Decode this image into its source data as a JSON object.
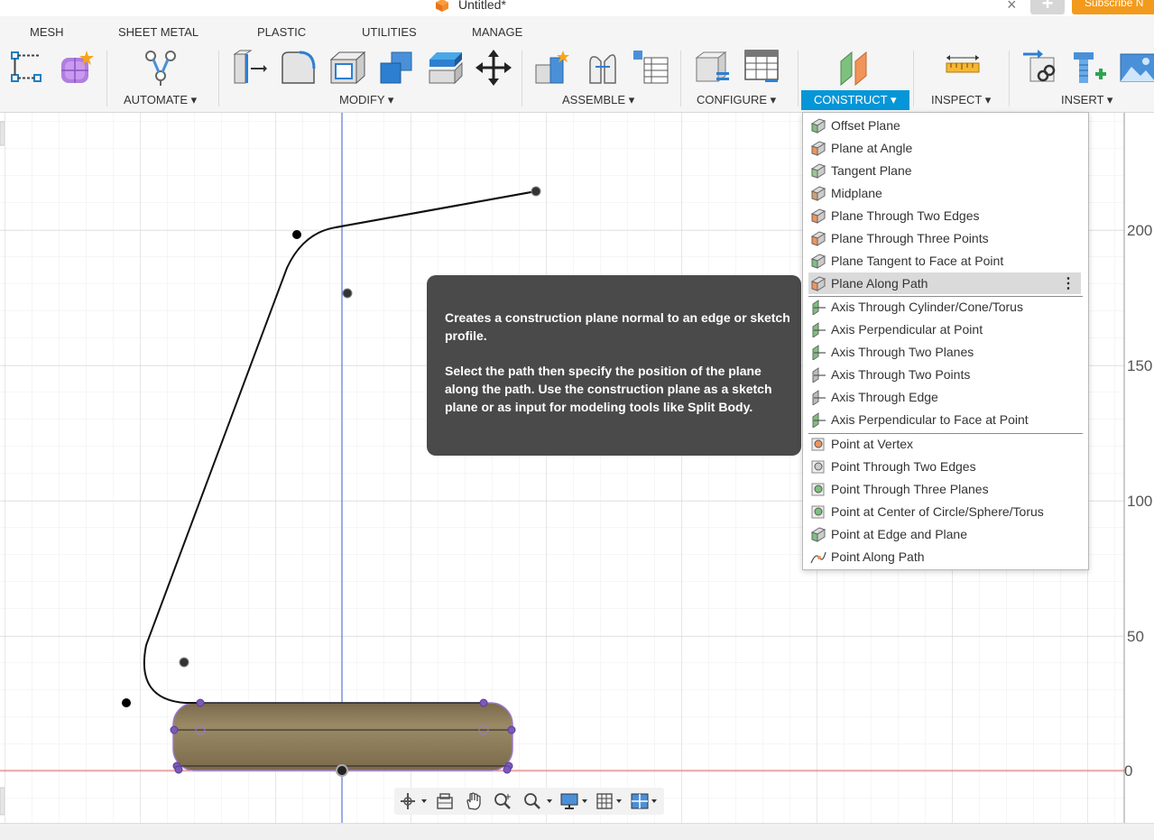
{
  "window": {
    "title": "Untitled*",
    "close_glyph": "×",
    "new_tab_glyph": "+",
    "subscribe_label": "Subscribe N"
  },
  "workspace_tabs": [
    "MESH",
    "SHEET METAL",
    "PLASTIC",
    "UTILITIES",
    "MANAGE"
  ],
  "toolbar_groups": {
    "automate": "AUTOMATE ▾",
    "modify": "MODIFY ▾",
    "assemble": "ASSEMBLE ▾",
    "configure": "CONFIGURE ▾",
    "construct": "CONSTRUCT ▾",
    "inspect": "INSPECT ▾",
    "insert": "INSERT ▾"
  },
  "toolbar_icons": [
    "sketch-constraint-icon",
    "form-create-icon",
    "automate-icon",
    "press-pull-icon",
    "fillet-icon",
    "shell-icon",
    "combine-icon",
    "offset-face-icon",
    "move-icon",
    "new-component-icon",
    "joint-icon",
    "bom-icon",
    "configure-table-icon",
    "configure-sheet-icon",
    "offset-plane-icon",
    "measure-icon",
    "insert-derive-icon",
    "insert-mcmaster-icon",
    "insert-image-icon"
  ],
  "construct_menu": {
    "items": [
      {
        "label": "Offset Plane",
        "icon": "offset-plane-icon"
      },
      {
        "label": "Plane at Angle",
        "icon": "plane-at-angle-icon"
      },
      {
        "label": "Tangent Plane",
        "icon": "tangent-plane-icon"
      },
      {
        "label": "Midplane",
        "icon": "midplane-icon"
      },
      {
        "label": "Plane Through Two Edges",
        "icon": "plane-two-edges-icon"
      },
      {
        "label": "Plane Through Three Points",
        "icon": "plane-three-points-icon"
      },
      {
        "label": "Plane Tangent to Face at Point",
        "icon": "plane-tangent-face-icon"
      },
      {
        "label": "Plane Along Path",
        "icon": "plane-along-path-icon",
        "highlighted": true
      },
      {
        "label": "Axis Through Cylinder/Cone/Torus",
        "icon": "axis-cylinder-icon"
      },
      {
        "label": "Axis Perpendicular at Point",
        "icon": "axis-perp-point-icon"
      },
      {
        "label": "Axis Through Two Planes",
        "icon": "axis-two-planes-icon"
      },
      {
        "label": "Axis Through Two Points",
        "icon": "axis-two-points-icon"
      },
      {
        "label": "Axis Through Edge",
        "icon": "axis-edge-icon"
      },
      {
        "label": "Axis Perpendicular to Face at Point",
        "icon": "axis-perp-face-icon"
      },
      {
        "label": "Point at Vertex",
        "icon": "point-vertex-icon"
      },
      {
        "label": "Point Through Two Edges",
        "icon": "point-two-edges-icon"
      },
      {
        "label": "Point Through Three Planes",
        "icon": "point-three-planes-icon"
      },
      {
        "label": "Point at Center of Circle/Sphere/Torus",
        "icon": "point-center-icon"
      },
      {
        "label": "Point at Edge and Plane",
        "icon": "point-edge-plane-icon"
      },
      {
        "label": "Point Along Path",
        "icon": "point-along-path-icon"
      }
    ],
    "more_glyph": "⋮"
  },
  "tooltip": {
    "paragraph1": "Creates a construction plane normal to an edge or sketch profile.",
    "paragraph2": "Select the path then specify the position of the plane along the path. Use the construction plane as a sketch plane or as input for modeling tools like Split Body."
  },
  "ruler_labels": [
    "200",
    "150",
    "100",
    "50",
    "0"
  ],
  "colors": {
    "accent": "#0696d7",
    "subscribe": "#f39a1c",
    "tooltip_bg": "#4a4a4a",
    "body_fill": "#8a7a5a",
    "axis_red": "#e06060",
    "axis_blue": "#3a5bd9"
  }
}
